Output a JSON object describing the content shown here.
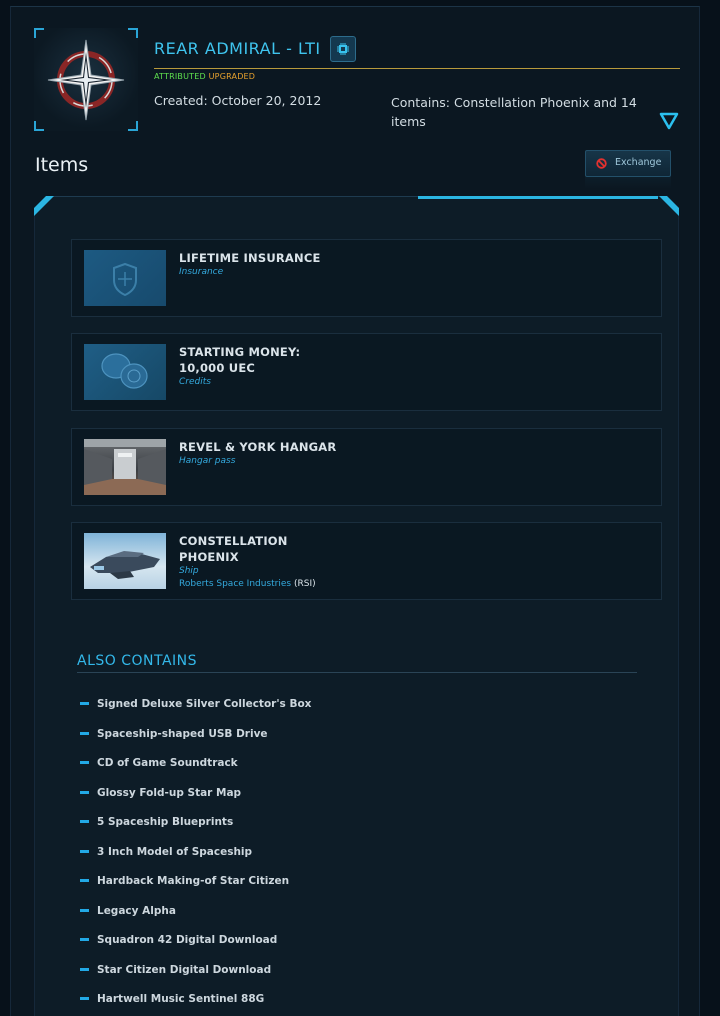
{
  "pledge": {
    "title": "REAR ADMIRAL - LTI",
    "tag_attributed": "ATTRIBUTED",
    "tag_upgraded": "UPGRADED",
    "created": "Created: October 20, 2012",
    "contains": "Contains: Constellation Phoenix and 14 items"
  },
  "section": {
    "items_heading": "Items",
    "exchange_label": "Exchange"
  },
  "items": [
    {
      "name": "LIFETIME INSURANCE",
      "kind": "Insurance",
      "maker": "",
      "maker_abbr": ""
    },
    {
      "name": "STARTING MONEY: 10,000 UEC",
      "kind": "Credits",
      "maker": "",
      "maker_abbr": ""
    },
    {
      "name": "REVEL & YORK HANGAR",
      "kind": "Hangar pass",
      "maker": "",
      "maker_abbr": ""
    },
    {
      "name": "CONSTELLATION PHOENIX",
      "kind": "Ship",
      "maker": "Roberts Space Industries",
      "maker_abbr": "(RSI)"
    }
  ],
  "also_contains": {
    "heading": "ALSO CONTAINS",
    "entries": [
      "Signed Deluxe Silver Collector's Box",
      "Spaceship-shaped USB Drive",
      "CD of Game Soundtrack",
      "Glossy Fold-up Star Map",
      "5 Spaceship Blueprints",
      "3 Inch Model of Spaceship",
      "Hardback Making-of Star Citizen",
      "Legacy Alpha",
      "Squadron 42 Digital Download",
      "Star Citizen Digital Download",
      "Hartwell Music Sentinel 88G"
    ]
  },
  "icons": {
    "pledge_emblem": "compass-star-icon",
    "badge": "chip-icon",
    "expand": "triangle-down-icon",
    "exchange": "ban-icon",
    "list_bullet": "dash-icon"
  },
  "colors": {
    "accent": "#2bb6e3",
    "title": "#3fc4ee",
    "attributed": "#5ee04e",
    "upgraded": "#e7a12e",
    "exchange_icon": "#e2312f"
  }
}
